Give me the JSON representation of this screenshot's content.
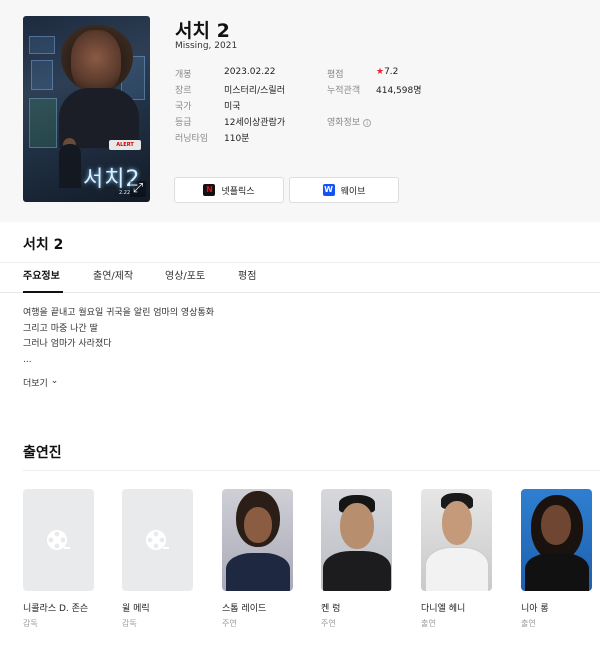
{
  "movie": {
    "title": "서치 2",
    "original": "Missing, 2021",
    "poster_title": "서치2",
    "poster_date": "2.22",
    "poster_alert": "ALERT"
  },
  "info": {
    "release_label": "개봉",
    "release": "2023.02.22",
    "genre_label": "장르",
    "genre": "미스터리/스릴러",
    "country_label": "국가",
    "country": "미국",
    "rating_label": "등급",
    "rating": "12세이상관람가",
    "runtime_label": "러닝타임",
    "runtime": "110분",
    "score_label": "평점",
    "score": "7.2",
    "audience_label": "누적관객",
    "audience": "414,598명",
    "promo_label": "영화정보"
  },
  "ott": [
    {
      "label": "넷플릭스",
      "color": "#e50914",
      "glyph": "N"
    },
    {
      "label": "웨이브",
      "color": "#1351f9",
      "glyph": "W"
    }
  ],
  "section_title": "서치 2",
  "tabs": [
    "주요정보",
    "출연/제작",
    "영상/포토",
    "평점"
  ],
  "synopsis": [
    "여행을 끝내고 월요일 귀국을 알린 엄마의 영상통화",
    "그리고 마중 나간 딸",
    "그러나 엄마가 사라졌다",
    "..."
  ],
  "more_label": "더보기",
  "cast_title": "출연진",
  "cast": [
    {
      "name": "니콜라스 D. 존슨",
      "role": "감독"
    },
    {
      "name": "윌 메릭",
      "role": "감독"
    },
    {
      "name": "스톰 레이드",
      "role": "주연"
    },
    {
      "name": "켄 렁",
      "role": "주연"
    },
    {
      "name": "다니엘 헤니",
      "role": "출연"
    },
    {
      "name": "니아 롱",
      "role": "출연"
    }
  ],
  "icons": {
    "star": "★",
    "expand": "⤢",
    "chevron": "⌄",
    "info": "i"
  }
}
